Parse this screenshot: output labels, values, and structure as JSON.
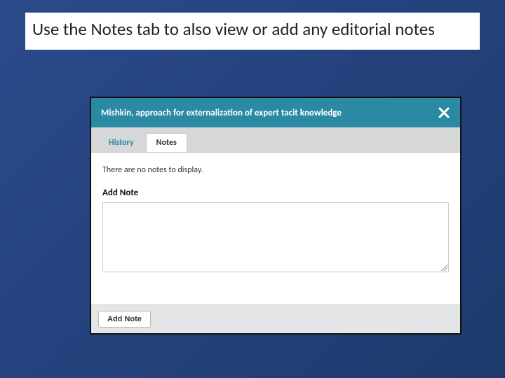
{
  "slide": {
    "title": "Use the Notes tab to also view or add any editorial notes"
  },
  "modal": {
    "title": "Mishkin, approach for externalization of expert tacit knowledge",
    "tabs": {
      "history": "History",
      "notes": "Notes"
    },
    "body": {
      "empty_message": "There are no notes to display.",
      "add_note_label": "Add Note"
    },
    "footer": {
      "add_button": "Add Note"
    }
  }
}
